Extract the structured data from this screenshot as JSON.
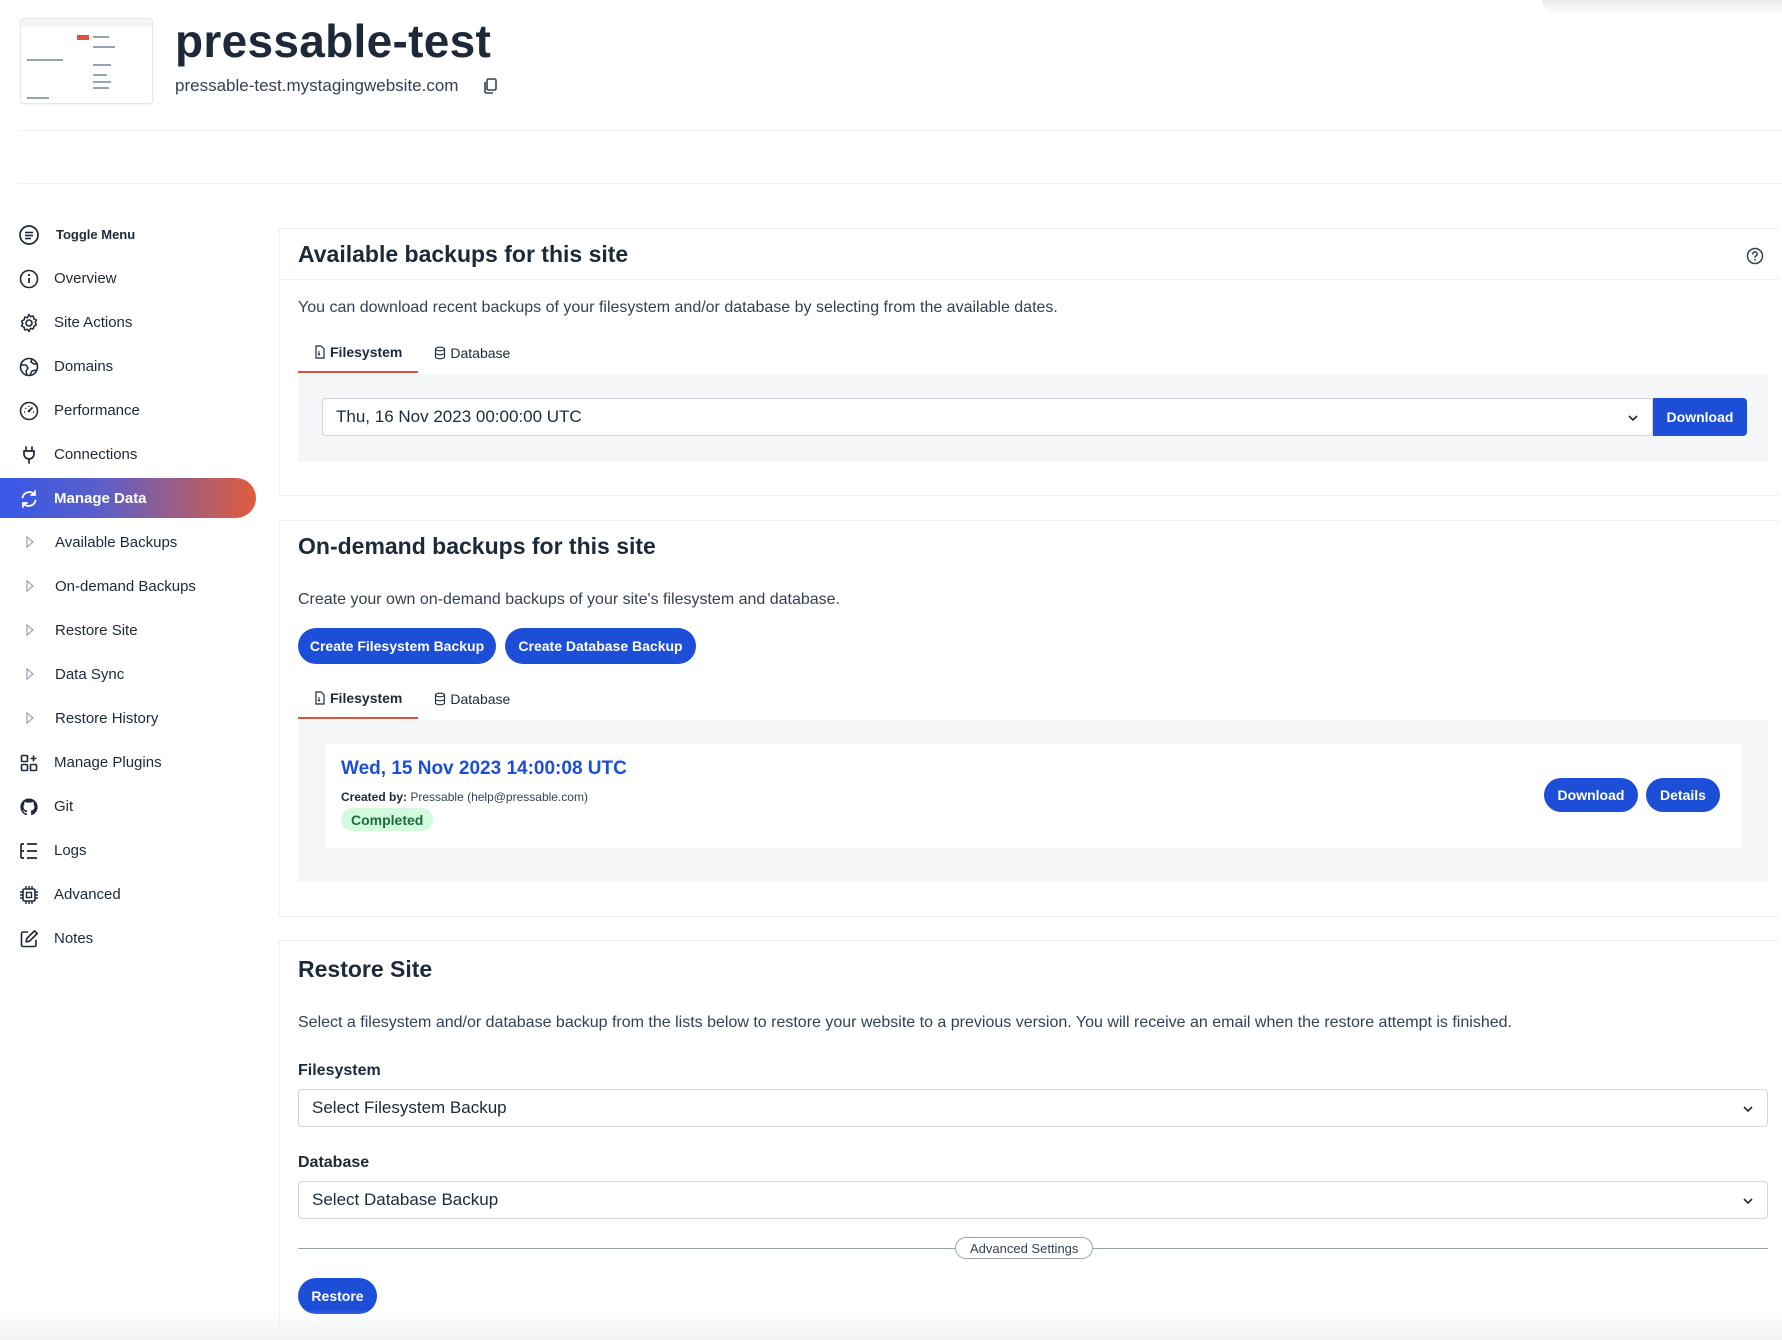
{
  "site": {
    "name": "pressable-test",
    "url": "pressable-test.mystagingwebsite.com"
  },
  "sidebar": {
    "toggle_label": "Toggle Menu",
    "items": [
      {
        "label": "Overview",
        "icon": "info-icon"
      },
      {
        "label": "Site Actions",
        "icon": "gear-icon"
      },
      {
        "label": "Domains",
        "icon": "globe-icon"
      },
      {
        "label": "Performance",
        "icon": "gauge-icon"
      },
      {
        "label": "Connections",
        "icon": "plug-icon"
      },
      {
        "label": "Manage Data",
        "icon": "sync-icon",
        "active": true
      },
      {
        "label": "Available Backups",
        "sub": true
      },
      {
        "label": "On-demand Backups",
        "sub": true
      },
      {
        "label": "Restore Site",
        "sub": true
      },
      {
        "label": "Data Sync",
        "sub": true
      },
      {
        "label": "Restore History",
        "sub": true
      },
      {
        "label": "Manage Plugins",
        "icon": "plugins-icon"
      },
      {
        "label": "Git",
        "icon": "github-icon"
      },
      {
        "label": "Logs",
        "icon": "list-icon"
      },
      {
        "label": "Advanced",
        "icon": "chip-icon"
      },
      {
        "label": "Notes",
        "icon": "edit-icon"
      }
    ]
  },
  "available_backups": {
    "title": "Available backups for this site",
    "description": "You can download recent backups of your filesystem and/or database by selecting from the available dates.",
    "tabs": [
      "Filesystem",
      "Database"
    ],
    "selected_date": "Thu, 16 Nov 2023 00:00:00 UTC",
    "download_label": "Download"
  },
  "ondemand_backups": {
    "title": "On-demand backups for this site",
    "description": "Create your own on-demand backups of your site's filesystem and database.",
    "create_fs_label": "Create Filesystem Backup",
    "create_db_label": "Create Database Backup",
    "tabs": [
      "Filesystem",
      "Database"
    ],
    "backup": {
      "date": "Wed, 15 Nov 2023 14:00:08 UTC",
      "created_by_label": "Created by:",
      "created_by": "Pressable (help@pressable.com)",
      "status": "Completed",
      "download_label": "Download",
      "details_label": "Details"
    }
  },
  "restore_site": {
    "title": "Restore Site",
    "description": "Select a filesystem and/or database backup from the lists below to restore your website to a previous version. You will receive an email when the restore attempt is finished.",
    "filesystem_label": "Filesystem",
    "filesystem_placeholder": "Select Filesystem Backup",
    "database_label": "Database",
    "database_placeholder": "Select Database Backup",
    "advanced_label": "Advanced Settings",
    "restore_label": "Restore"
  },
  "colors": {
    "primary": "#1d4ed8",
    "accent_tab": "#e04f39",
    "status_bg": "#d1fadf"
  }
}
